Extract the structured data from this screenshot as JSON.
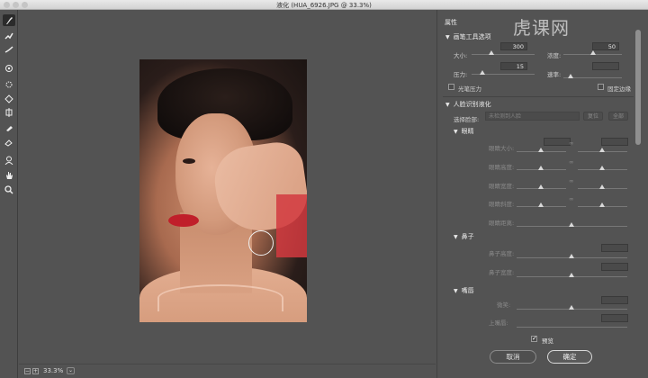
{
  "window": {
    "title": "液化 (HUA_6926.JPG @ 33.3%)"
  },
  "watermark": {
    "text": "虎课网"
  },
  "tools": [
    {
      "name": "forward-warp-tool",
      "active": true
    },
    {
      "name": "reconstruct-tool"
    },
    {
      "name": "smooth-tool"
    },
    {
      "name": "twirl-clockwise-tool"
    },
    {
      "name": "pucker-tool"
    },
    {
      "name": "bloat-tool"
    },
    {
      "name": "push-left-tool"
    },
    {
      "name": "freeze-mask-tool"
    },
    {
      "name": "thaw-mask-tool"
    },
    {
      "name": "face-tool"
    },
    {
      "name": "hand-tool"
    },
    {
      "name": "zoom-tool"
    }
  ],
  "zoom": {
    "value": "33.3%",
    "minus": "−",
    "plus": "+",
    "arrow": "⌄"
  },
  "panel": {
    "title": "属性",
    "brush_section": {
      "label": "画笔工具选项",
      "size_label": "大小:",
      "size_value": "300",
      "density_label": "浓度:",
      "density_value": "50",
      "pressure_label": "压力:",
      "pressure_value": "15",
      "rate_label": "速率:",
      "rate_value": "",
      "stylus_label": "光笔压力",
      "pin_edges_label": "固定边缘"
    },
    "face_section": {
      "label": "人脸识别液化",
      "select_face_label": "选择脸部:",
      "select_face_value": "未检测到人脸",
      "reset_label": "复位",
      "all_label": "全部"
    },
    "eyes": {
      "label": "眼睛",
      "rows": [
        "眼睛大小:",
        "眼睛高度:",
        "眼睛宽度:",
        "眼睛斜度:",
        "眼睛距离:"
      ],
      "link_icon": "∞"
    },
    "nose": {
      "label": "鼻子",
      "rows": [
        "鼻子高度:",
        "鼻子宽度:"
      ]
    },
    "mouth": {
      "label": "嘴唇",
      "rows": [
        "微笑:",
        "上嘴唇:"
      ]
    },
    "preview_label": "预览",
    "cancel_label": "取消",
    "ok_label": "确定"
  }
}
